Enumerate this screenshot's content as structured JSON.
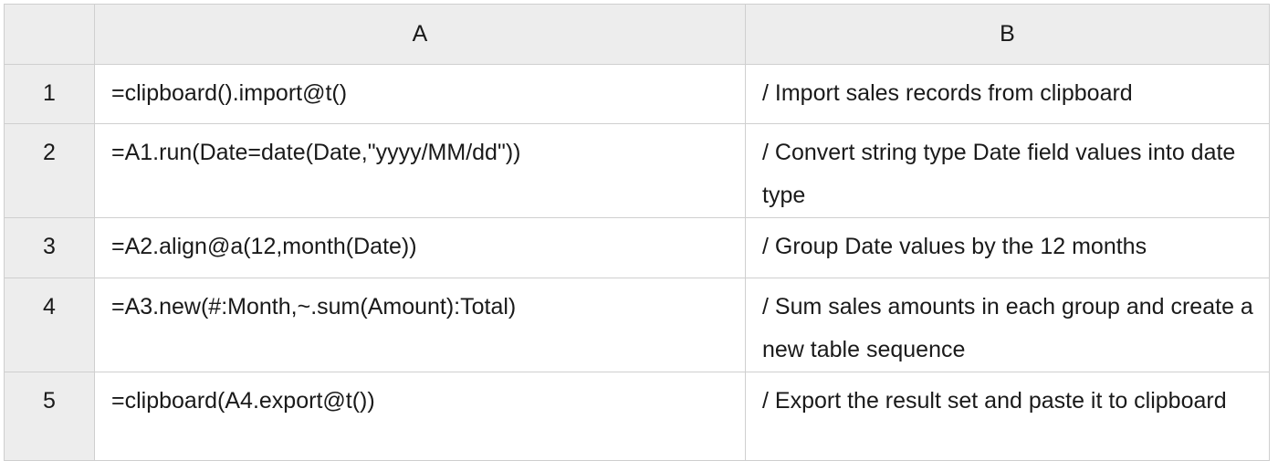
{
  "columns": {
    "corner": "",
    "a": "A",
    "b": "B"
  },
  "rows": [
    {
      "num": "1",
      "a": "=clipboard().import@t()",
      "b": "/ Import sales records from clipboard"
    },
    {
      "num": "2",
      "a": "=A1.run(Date=date(Date,\"yyyy/MM/dd\"))",
      "b": "/ Convert string type Date field values into date type"
    },
    {
      "num": "3",
      "a": "=A2.align@a(12,month(Date))",
      "b": "/ Group Date values by the 12 months"
    },
    {
      "num": "4",
      "a": "=A3.new(#:Month,~.sum(Amount):Total)",
      "b": "/ Sum sales amounts in each group and create a new table sequence"
    },
    {
      "num": "5",
      "a": "=clipboard(A4.export@t())",
      "b": "/ Export the result set and paste it to clipboard"
    }
  ],
  "colors": {
    "header_bg": "#ededed",
    "grid_line": "#cfcfcf",
    "cell_bg": "#ffffff"
  }
}
